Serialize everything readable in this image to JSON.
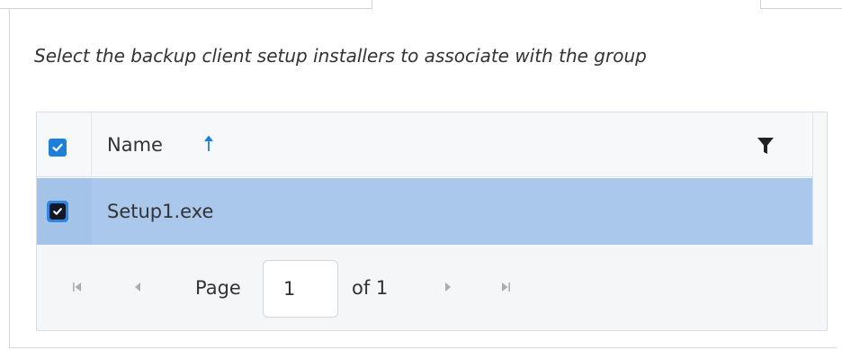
{
  "instruction": "Select the backup client setup installers to associate with the group",
  "grid": {
    "columns": [
      {
        "label": "Name",
        "sort": "ascending"
      }
    ],
    "select_all_checked": true,
    "rows": [
      {
        "name": "Setup1.exe",
        "selected": true
      }
    ],
    "pager": {
      "page_label": "Page",
      "current_page": "1",
      "of_label": "of 1"
    }
  },
  "icons": {
    "sort": "arrow-up-icon",
    "filter": "funnel-icon",
    "first": "first-page-icon",
    "prev": "previous-page-icon",
    "next": "next-page-icon",
    "last": "last-page-icon"
  },
  "colors": {
    "accent": "#1e7fd8",
    "selected_row": "#a9c8ec",
    "sort_arrow": "#1e7fd8"
  }
}
